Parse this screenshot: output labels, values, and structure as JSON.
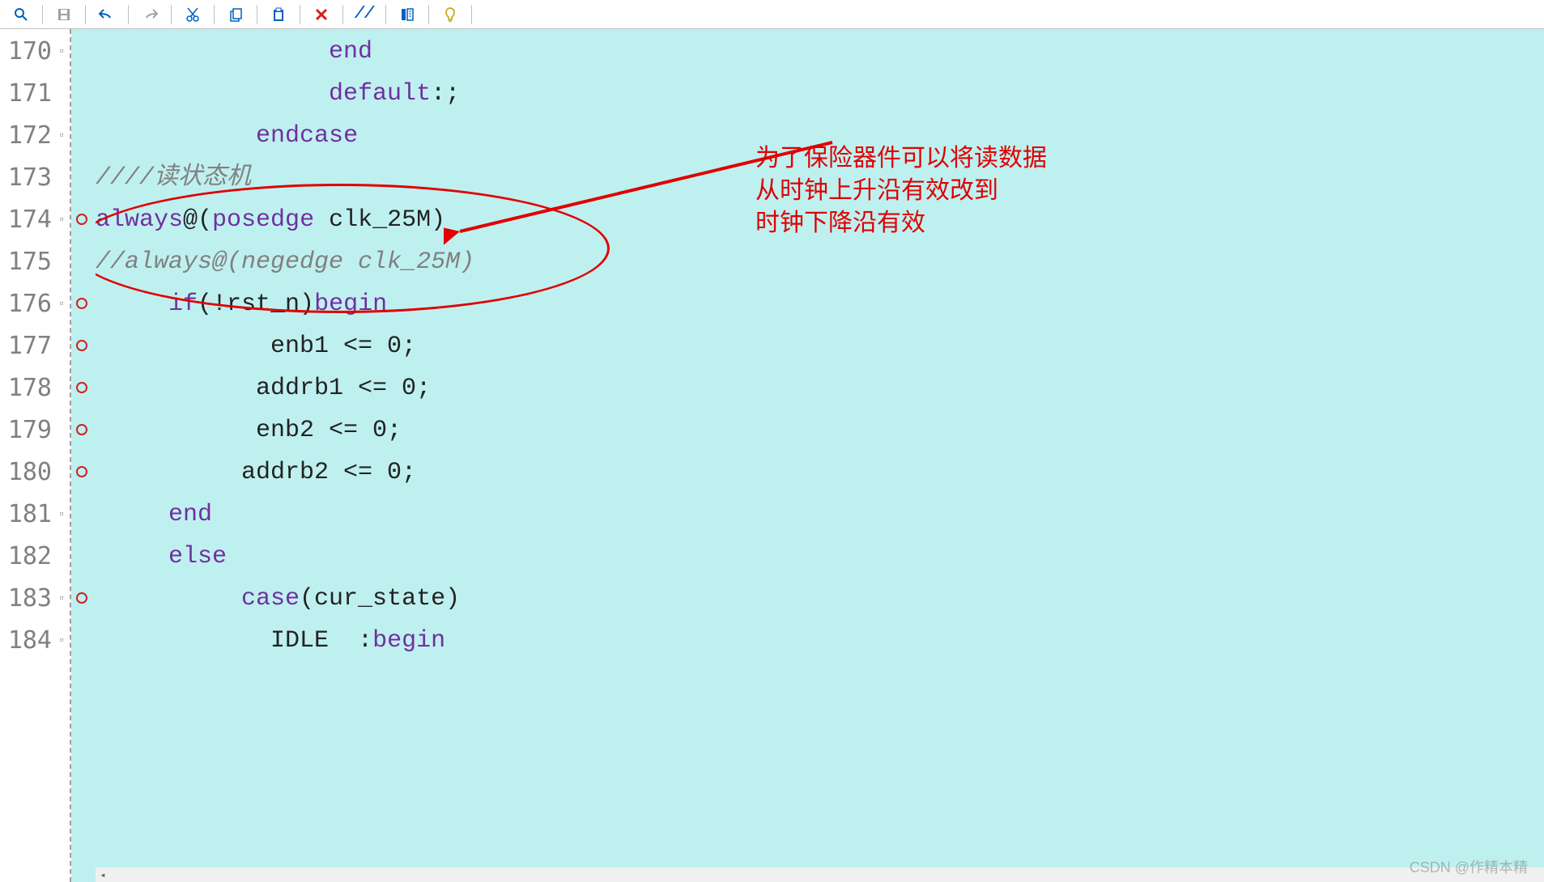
{
  "toolbar": {
    "icons": [
      "search",
      "save",
      "undo",
      "redo",
      "cut",
      "copy",
      "paste",
      "delete",
      "comment",
      "format",
      "hint"
    ]
  },
  "annotation": {
    "line1": "为了保险器件可以将读数据",
    "line2": "从时钟上升沿有效改到",
    "line3": "时钟下降沿有效"
  },
  "watermark": "CSDN @作精本精",
  "code": {
    "lines": [
      {
        "num": "170",
        "fold": "⊟",
        "bp": false,
        "tokens": [
          {
            "t": "                ",
            "c": "txt"
          },
          {
            "t": "end",
            "c": "kw"
          }
        ]
      },
      {
        "num": "171",
        "fold": "",
        "bp": false,
        "tokens": [
          {
            "t": "                ",
            "c": "txt"
          },
          {
            "t": "default",
            "c": "kw"
          },
          {
            "t": ":;",
            "c": "txt"
          }
        ]
      },
      {
        "num": "172",
        "fold": "⊟",
        "bp": false,
        "tokens": [
          {
            "t": "           ",
            "c": "txt"
          },
          {
            "t": "endcase",
            "c": "kw"
          }
        ]
      },
      {
        "num": "173",
        "fold": "",
        "bp": false,
        "tokens": [
          {
            "t": "////读状态机",
            "c": "cm"
          }
        ]
      },
      {
        "num": "174",
        "fold": "⊟",
        "bp": true,
        "tokens": [
          {
            "t": "always",
            "c": "kw"
          },
          {
            "t": "@(",
            "c": "txt"
          },
          {
            "t": "posedge",
            "c": "kw"
          },
          {
            "t": " clk_25M)",
            "c": "txt"
          }
        ]
      },
      {
        "num": "175",
        "fold": "",
        "bp": false,
        "tokens": [
          {
            "t": "//always@(negedge clk_25M)",
            "c": "cm"
          }
        ]
      },
      {
        "num": "176",
        "fold": "⊟",
        "bp": true,
        "tokens": [
          {
            "t": "     ",
            "c": "txt"
          },
          {
            "t": "if",
            "c": "kw"
          },
          {
            "t": "(!rst_n)",
            "c": "txt"
          },
          {
            "t": "begin",
            "c": "kw"
          }
        ]
      },
      {
        "num": "177",
        "fold": "",
        "bp": true,
        "tokens": [
          {
            "t": "            enb1 <= 0;",
            "c": "txt"
          }
        ]
      },
      {
        "num": "178",
        "fold": "",
        "bp": true,
        "tokens": [
          {
            "t": "           addrb1 <= 0;",
            "c": "txt"
          }
        ]
      },
      {
        "num": "179",
        "fold": "",
        "bp": true,
        "tokens": [
          {
            "t": "           enb2 <= 0;",
            "c": "txt"
          }
        ]
      },
      {
        "num": "180",
        "fold": "",
        "bp": true,
        "tokens": [
          {
            "t": "          addrb2 <= 0;",
            "c": "txt"
          }
        ]
      },
      {
        "num": "181",
        "fold": "⊟",
        "bp": false,
        "tokens": [
          {
            "t": "     ",
            "c": "txt"
          },
          {
            "t": "end",
            "c": "kw"
          }
        ]
      },
      {
        "num": "182",
        "fold": "",
        "bp": false,
        "tokens": [
          {
            "t": "     ",
            "c": "txt"
          },
          {
            "t": "else",
            "c": "kw"
          }
        ]
      },
      {
        "num": "183",
        "fold": "⊟",
        "bp": true,
        "tokens": [
          {
            "t": "          ",
            "c": "txt"
          },
          {
            "t": "case",
            "c": "kw"
          },
          {
            "t": "(cur_state)",
            "c": "txt"
          }
        ]
      },
      {
        "num": "184",
        "fold": "⊟",
        "bp": false,
        "tokens": [
          {
            "t": "            IDLE  :",
            "c": "txt"
          },
          {
            "t": "begin",
            "c": "kw"
          }
        ]
      }
    ]
  }
}
